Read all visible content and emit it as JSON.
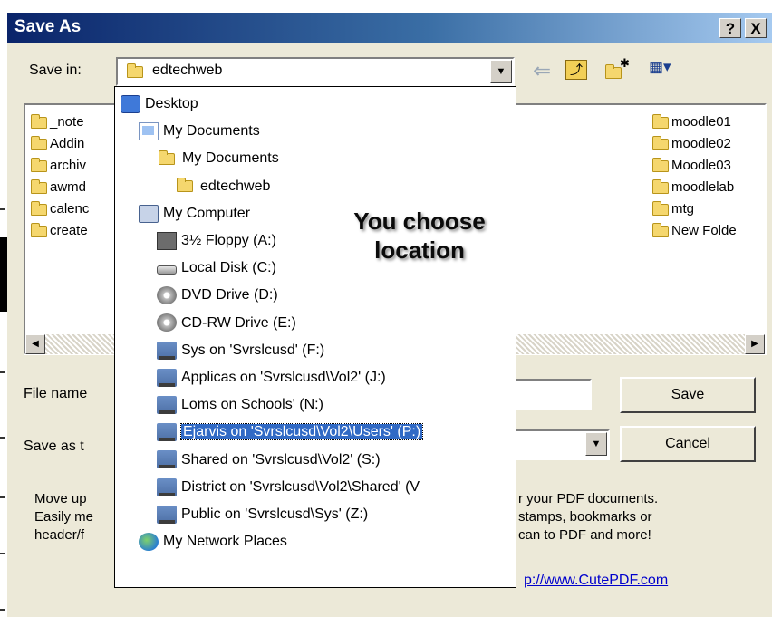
{
  "dialog": {
    "title": "Save As",
    "help_glyph": "?",
    "close_glyph": "X"
  },
  "toolbar": {
    "save_in_label": "Save in:",
    "current_folder": "edtechweb",
    "back_glyph": "⇐",
    "up_glyph": "⤴",
    "new_folder_glyph": "✱",
    "views_glyph": "▦▾"
  },
  "files_left": [
    "_note",
    "Addin",
    "archiv",
    "awmd",
    "calenc",
    "create"
  ],
  "files_right": [
    "moodle01",
    "moodle02",
    "Moodle03",
    "moodlelab",
    "mtg",
    "New Folde"
  ],
  "file_name_label": "File name",
  "save_as_type_label": "Save as t",
  "buttons": {
    "save": "Save",
    "cancel": "Cancel"
  },
  "dropdown_items": [
    {
      "label": "Desktop",
      "icon": "desktop-icon"
    },
    {
      "label": "My Documents",
      "icon": "my-documents-icon"
    },
    {
      "label": "My Documents",
      "icon": "folder-icon"
    },
    {
      "label": "edtechweb",
      "icon": "folder-icon"
    },
    {
      "label": "My Computer",
      "icon": "computer-icon"
    },
    {
      "label": "3½ Floppy (A:)",
      "icon": "floppy-icon"
    },
    {
      "label": "Local Disk (C:)",
      "icon": "hard-disk-icon"
    },
    {
      "label": "DVD Drive (D:)",
      "icon": "dvd-drive-icon"
    },
    {
      "label": "CD-RW Drive (E:)",
      "icon": "cd-drive-icon"
    },
    {
      "label": "Sys on 'Svrslcusd' (F:)",
      "icon": "network-drive-icon"
    },
    {
      "label": "Applicas on 'Svrslcusd\\Vol2' (J:)",
      "icon": "network-drive-icon"
    },
    {
      "label": "Loms on Schools' (N:)",
      "icon": "network-drive-icon"
    },
    {
      "label": "Ejarvis on 'Svrslcusd\\Vol2\\Users' (P:)",
      "icon": "network-drive-icon",
      "selected": true
    },
    {
      "label": "Shared on 'Svrslcusd\\Vol2' (S:)",
      "icon": "network-drive-icon"
    },
    {
      "label": "District on 'Svrslcusd\\Vol2\\Shared' (V",
      "icon": "network-drive-icon"
    },
    {
      "label": "Public on 'Svrslcusd\\Sys' (Z:)",
      "icon": "network-drive-icon"
    },
    {
      "label": "My Network Places",
      "icon": "network-places-icon"
    }
  ],
  "callout": {
    "line1": "You choose",
    "line2": "location"
  },
  "promo": {
    "left": [
      "Move up",
      "Easily me",
      "header/f"
    ],
    "right": [
      "r your PDF documents.",
      "stamps, bookmarks or",
      "can to PDF and more!"
    ],
    "link": "p://www.CutePDF.com"
  }
}
